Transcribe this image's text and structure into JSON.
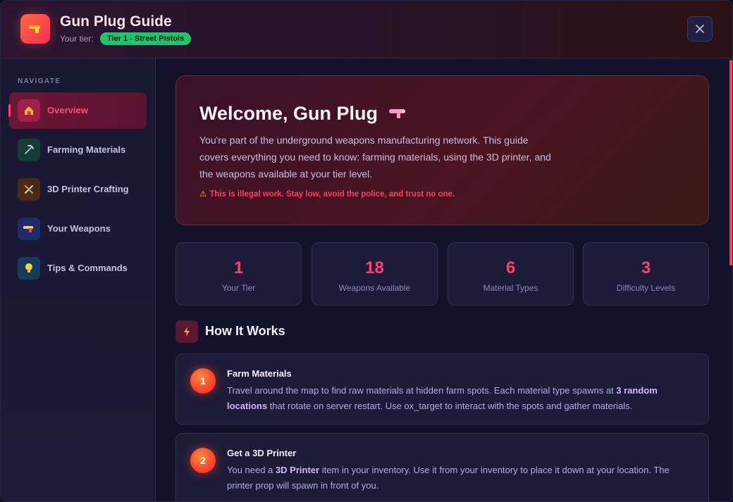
{
  "header": {
    "title": "Gun Plug Guide",
    "tier_label": "Your tier:",
    "tier_badge": "Tier 1 - Street Pistols",
    "close_icon": "close-icon",
    "app_icon": "pistol-icon"
  },
  "sidebar": {
    "heading": "NAVIGATE",
    "items": [
      {
        "label": "Overview",
        "icon": "house-icon",
        "active": true
      },
      {
        "label": "Farming Materials",
        "icon": "pickaxe-icon",
        "active": false
      },
      {
        "label": "3D Printer Crafting",
        "icon": "tools-icon",
        "active": false
      },
      {
        "label": "Your Weapons",
        "icon": "pistol-icon",
        "active": false
      },
      {
        "label": "Tips & Commands",
        "icon": "lightbulb-icon",
        "active": false
      }
    ]
  },
  "welcome": {
    "title": "Welcome, Gun Plug",
    "description": "You're part of the underground weapons manufacturing network. This guide covers everything you need to know: farming materials, using the 3D printer, and the weapons available at your tier level.",
    "warning": "This is illegal work. Stay low, avoid the police, and trust no one."
  },
  "stats": [
    {
      "value": "1",
      "label": "Your Tier"
    },
    {
      "value": "18",
      "label": "Weapons Available"
    },
    {
      "value": "6",
      "label": "Material Types"
    },
    {
      "value": "3",
      "label": "Difficulty Levels"
    }
  ],
  "how_it_works": {
    "title": "How It Works",
    "icon": "lightning-icon",
    "steps": [
      {
        "number": "1",
        "title": "Farm Materials",
        "body_before": "Travel around the map to find raw materials at hidden farm spots. Each material type spawns at ",
        "body_bold": "3 random locations",
        "body_after": " that rotate on server restart. Use ox_target to interact with the spots and gather materials."
      },
      {
        "number": "2",
        "title": "Get a 3D Printer",
        "body_before": "You need a ",
        "body_bold": "3D Printer",
        "body_after": " item in your inventory. Use it from your inventory to place it down at your location. The printer prop will spawn in front of you."
      }
    ]
  },
  "colors": {
    "accent": "#ff3d6e",
    "badge_green": "#1fc46e",
    "warning_red": "#ff3d5e"
  }
}
